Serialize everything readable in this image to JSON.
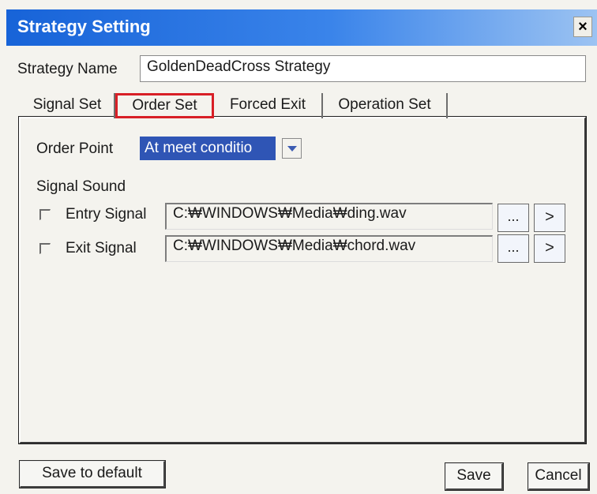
{
  "window": {
    "title": "Strategy Setting",
    "close_label": "×"
  },
  "strategy_name": {
    "label": "Strategy Name",
    "value": "GoldenDeadCross Strategy"
  },
  "tabs": [
    {
      "label": "Signal Set",
      "active": false
    },
    {
      "label": "Order Set",
      "active": true
    },
    {
      "label": "Forced  Exit",
      "active": false
    },
    {
      "label": "Operation Set",
      "active": false
    }
  ],
  "order_point": {
    "label": "Order Point",
    "selected": "At meet conditio"
  },
  "signal_sound": {
    "heading": "Signal Sound",
    "entry": {
      "label": "Entry Signal",
      "checked": false,
      "path": "C:₩WINDOWS₩Media₩ding.wav",
      "browse_label": "...",
      "play_label": ">"
    },
    "exit": {
      "label": "Exit Signal",
      "checked": false,
      "path": "C:₩WINDOWS₩Media₩chord.wav",
      "browse_label": "...",
      "play_label": ">"
    }
  },
  "buttons": {
    "save_default": "Save to default",
    "save": "Save",
    "cancel": "Cancel"
  },
  "colors": {
    "titlebar_start": "#1763d8",
    "titlebar_end": "#9cc3f2",
    "active_tab_outline": "#d81f26",
    "selection": "#2f55b5"
  }
}
